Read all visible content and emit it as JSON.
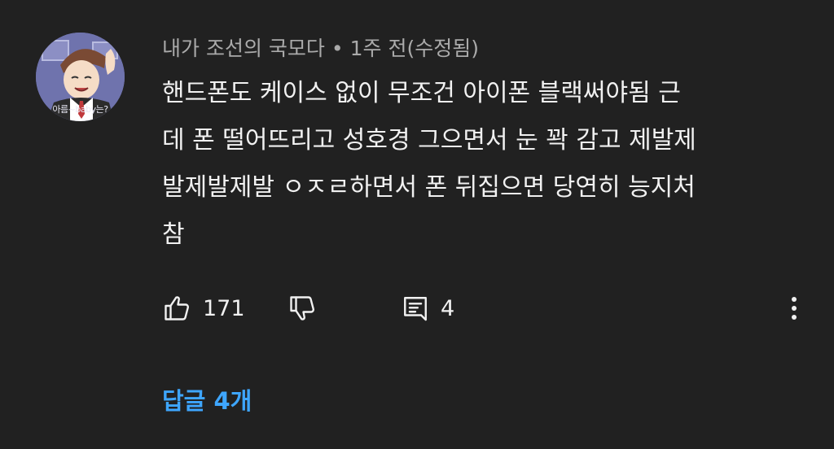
{
  "comment": {
    "avatar_caption": "아름~baby는?",
    "author": "내가 조선의 국모다",
    "separator": "•",
    "time": "1주 전(수정됨)",
    "text_lines": [
      "핸드폰도 케이스 없이 무조건 아이폰 블랙써야됨 근",
      "데  폰 떨어뜨리고 성호경 그으면서 눈 꽉 감고 제발제",
      "발제발제발 ㅇㅈㄹ하면서 폰 뒤집으면 당연히 능지처",
      "참"
    ],
    "like_count": "171",
    "reply_count": "4",
    "replies_link": "답글 4개"
  },
  "icons": {
    "like": "thumbs-up-icon",
    "dislike": "thumbs-down-icon",
    "reply": "comment-icon",
    "more": "more-vertical-icon"
  },
  "colors": {
    "background": "#212121",
    "text": "#f1f1f1",
    "meta": "#aaaaaa",
    "link": "#3ea6ff"
  }
}
